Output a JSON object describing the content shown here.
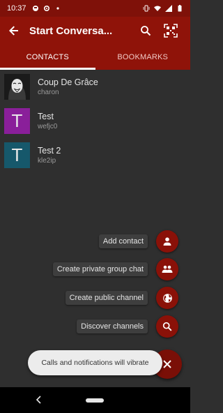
{
  "status_bar": {
    "time": "10:37"
  },
  "app_bar": {
    "title": "Start Conversa...",
    "back_icon": "arrow-back-icon",
    "search_icon": "search-icon",
    "qr_icon": "qr-scan-icon"
  },
  "tabs": [
    {
      "label": "CONTACTS",
      "active": true
    },
    {
      "label": "BOOKMARKS",
      "active": false
    }
  ],
  "contacts": [
    {
      "initial": "",
      "name": "Coup De Grâce",
      "sub": "charon",
      "avatar_color": "#1a1a1a",
      "avatar_kind": "image"
    },
    {
      "initial": "T",
      "name": "Test",
      "sub": "wefjc0",
      "avatar_color": "#8a1f9a",
      "avatar_kind": "letter"
    },
    {
      "initial": "T",
      "name": "Test 2",
      "sub": "kle2ip",
      "avatar_color": "#16586b",
      "avatar_kind": "letter"
    }
  ],
  "speed_dial": [
    {
      "label": "Add contact",
      "icon": "person-icon"
    },
    {
      "label": "Create private group chat",
      "icon": "group-icon"
    },
    {
      "label": "Create public channel",
      "icon": "globe-icon"
    },
    {
      "label": "Discover channels",
      "icon": "search-icon"
    }
  ],
  "fab": {
    "icon": "close-icon"
  },
  "snackbar": {
    "text": "Calls and notifications will vibrate"
  },
  "colors": {
    "accent": "#8f1309",
    "background": "#2f2f2f"
  }
}
